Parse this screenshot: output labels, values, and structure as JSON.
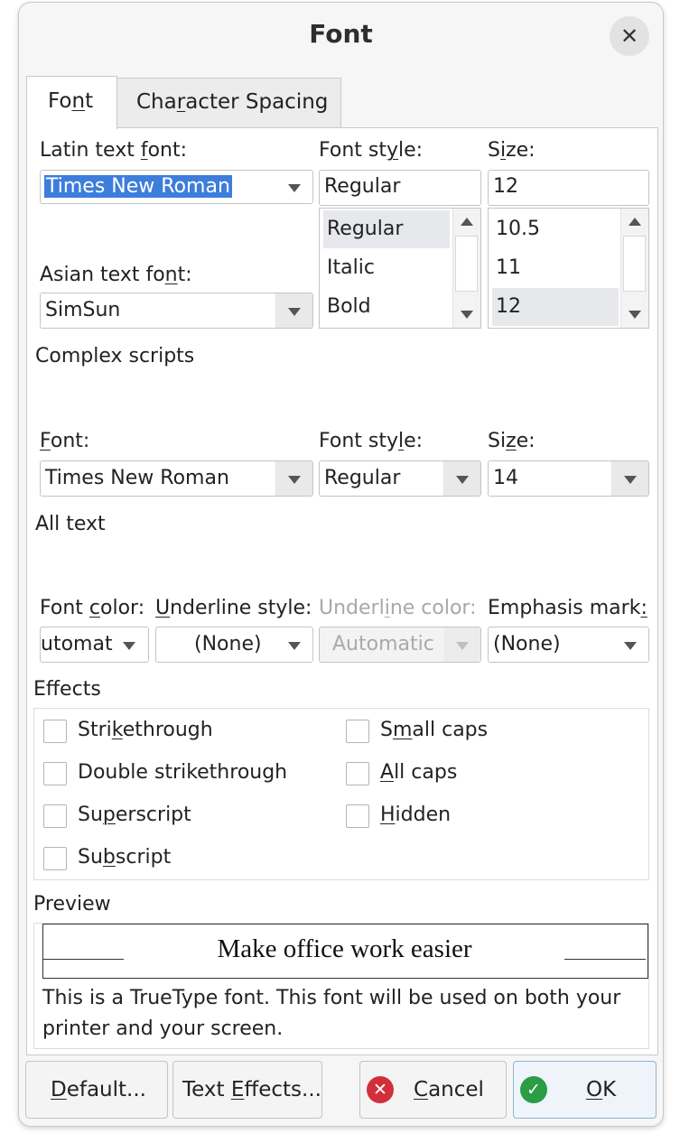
{
  "window": {
    "title": "Font",
    "close_label": "✕"
  },
  "tabs": [
    {
      "pre": "Fo",
      "key": "n",
      "post": "t",
      "active": true
    },
    {
      "pre": "Cha",
      "key": "r",
      "post": "acter Spacing",
      "active": false
    }
  ],
  "western": {
    "font_label": {
      "pre": "Latin text ",
      "key": "f",
      "post": "ont:"
    },
    "font_value": "Times New Roman",
    "style_label": {
      "pre": "Font st",
      "key": "y",
      "post": "le:"
    },
    "style_value": "Regular",
    "style_items": [
      "Regular",
      "Italic",
      "Bold"
    ],
    "size_label": {
      "pre": "S",
      "key": "i",
      "post": "ze:"
    },
    "size_value": "12",
    "size_items": [
      "10.5",
      "11",
      "12"
    ]
  },
  "asian": {
    "font_label": {
      "pre": "Asian text fo",
      "key": "n",
      "post": "t:"
    },
    "font_value": "SimSun"
  },
  "complex": {
    "heading": "Complex scripts",
    "font_label": {
      "pre": "",
      "key": "F",
      "post": "ont:"
    },
    "font_value": "Times New Roman",
    "style_label": {
      "pre": "Font sty",
      "key": "l",
      "post": "e:"
    },
    "style_value": "Regular",
    "size_label": {
      "pre": "Si",
      "key": "z",
      "post": "e:"
    },
    "size_value": "14"
  },
  "all_text": {
    "heading": "All text",
    "font_color_label": {
      "pre": "Font ",
      "key": "c",
      "post": "olor:"
    },
    "font_color_value": "utomat",
    "underline_style_label": {
      "pre": "",
      "key": "U",
      "post": "nderline style:"
    },
    "underline_style_value": "(None)",
    "underline_color_label": {
      "pre": "Underl",
      "key": "i",
      "post": "ne color:"
    },
    "underline_color_value": "Automatic",
    "emphasis_label": {
      "pre": "Emphasis mark",
      "key": ":",
      "post": ""
    },
    "emphasis_value": "(None)"
  },
  "effects": {
    "heading": "Effects",
    "strikethrough": {
      "pre": "Stri",
      "key": "k",
      "post": "ethrough"
    },
    "double_strikethrough": "Double strikethrough",
    "superscript": {
      "pre": "Su",
      "key": "p",
      "post": "erscript"
    },
    "subscript": {
      "pre": "Su",
      "key": "b",
      "post": "script"
    },
    "small_caps": {
      "pre": "S",
      "key": "m",
      "post": "all caps"
    },
    "all_caps": {
      "pre": "",
      "key": "A",
      "post": "ll caps"
    },
    "hidden": {
      "pre": "",
      "key": "H",
      "post": "idden"
    }
  },
  "preview": {
    "heading": "Preview",
    "sample": "Make office work easier",
    "note_line1": "This is a TrueType font. This font will be used on both your",
    "note_line2": "printer and your screen."
  },
  "buttons": {
    "default": {
      "pre": "",
      "key": "D",
      "post": "efault..."
    },
    "text_effects": {
      "pre": "Text ",
      "key": "E",
      "post": "ffects..."
    },
    "cancel": {
      "pre": "",
      "key": "C",
      "post": "ancel"
    },
    "ok": {
      "pre": "",
      "key": "O",
      "post": "K"
    }
  },
  "colors": {
    "accent": "#3d7ddc",
    "cancel_icon": "#d32f3a",
    "ok_icon": "#2a9d46"
  }
}
